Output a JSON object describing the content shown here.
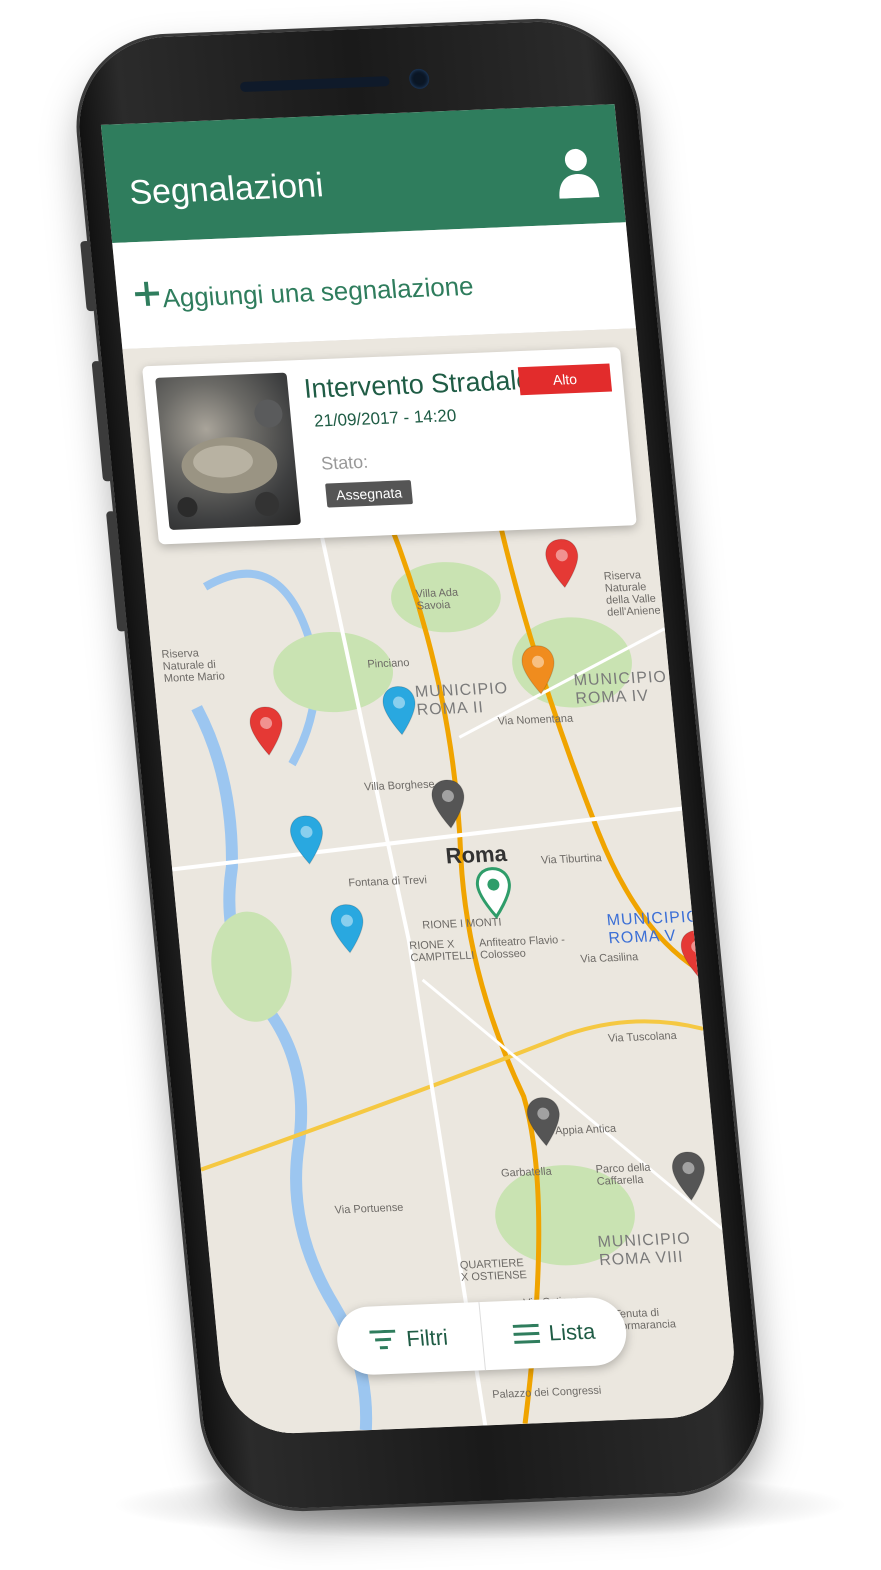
{
  "header": {
    "title": "Segnalazioni",
    "user_icon": "user-icon"
  },
  "actions": {
    "add_label": "Aggiungi una segnalazione"
  },
  "card": {
    "title": "Intervento Stradale",
    "datetime": "21/09/2017 - 14:20",
    "status_label": "Stato:",
    "status_value": "Assegnata",
    "priority": "Alto"
  },
  "map": {
    "labels": {
      "villa_ada": "Villa Ada Savoia",
      "pinciano": "Pinciano",
      "municipio_ii": "MUNICIPIO ROMA II",
      "municipio_iv": "MUNICIPIO ROMA IV",
      "villa_borghese": "Villa Borghese",
      "roma": "Roma",
      "fontana_trevi": "Fontana di Trevi",
      "rione_monti": "RIONE I MONTI",
      "campitelli": "RIONE X CAMPITELLI",
      "colosseo": "Anfiteatro Flavio - Colosseo",
      "municipio_v": "MUNICIPIO ROMA V",
      "garbatella": "Garbatella",
      "caffarella": "Parco della Caffarella",
      "municipio_viii": "MUNICIPIO ROMA VIII",
      "ostiense": "QUARTIERE X OSTIENSE",
      "tormarancia": "Tenuta di Tormarancia",
      "riserva_aniene": "Riserva Naturale della Valle dell'Aniene",
      "riserva_monte_mario": "Riserva Naturale di Monte Mario",
      "via_casilina": "Via Casilina",
      "via_nomentana": "Via Nomentana",
      "via_tiburtina": "Via Tiburtina",
      "via_tuscolana": "Via Tuscolana",
      "via_appia": "Via Appia Antica",
      "via_portuense": "Via Portuense",
      "via_ostiense": "Via Ostiense",
      "palazzo_congressi": "Palazzo dei Congressi"
    },
    "pins": [
      {
        "color": "#e53935"
      },
      {
        "color": "#e53935"
      },
      {
        "color": "#f08c1e"
      },
      {
        "color": "#29a8e0"
      },
      {
        "color": "#29a8e0"
      },
      {
        "color": "#29a8e0"
      },
      {
        "color": "#555555"
      },
      {
        "color": "#ffffff"
      },
      {
        "color": "#e53935"
      },
      {
        "color": "#555555"
      },
      {
        "color": "#555555"
      }
    ]
  },
  "bottom_bar": {
    "filters_label": "Filtri",
    "list_label": "Lista"
  },
  "colors": {
    "primary": "#2f7d5d",
    "priority_high": "#e22c2c",
    "status_badge": "#555555"
  }
}
